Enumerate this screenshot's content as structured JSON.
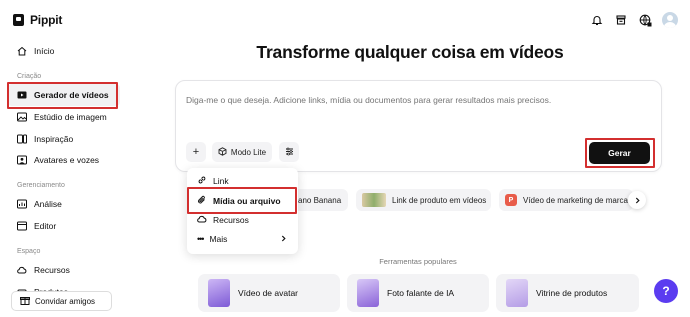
{
  "app": {
    "brand": "Pippit"
  },
  "sidebar": {
    "items": [
      {
        "label": "Início",
        "icon": "home-icon"
      },
      {
        "label": "Gerador de vídeos",
        "icon": "video-generator-icon"
      },
      {
        "label": "Estúdio de imagem",
        "icon": "image-studio-icon"
      },
      {
        "label": "Inspiração",
        "icon": "inspiration-icon"
      },
      {
        "label": "Avatares e vozes",
        "icon": "avatar-voice-icon"
      },
      {
        "label": "Análise",
        "icon": "analytics-icon"
      },
      {
        "label": "Editor",
        "icon": "editor-icon"
      },
      {
        "label": "Recursos",
        "icon": "cloud-icon"
      },
      {
        "label": "Produtos",
        "icon": "products-icon"
      }
    ],
    "sections": {
      "creation": "Criação",
      "management": "Gerenciamento",
      "space": "Espaço"
    },
    "invite_label": "Convidar amigos",
    "active_item": "Gerador de vídeos"
  },
  "header": {
    "icons": [
      "bell-icon",
      "archive-icon",
      "language-icon",
      "user-avatar"
    ]
  },
  "main": {
    "title": "Transforme qualquer coisa em vídeos",
    "prompt_placeholder": "Diga-me o que deseja. Adicione links, mídia ou documentos para gerar resultados mais precisos.",
    "add_label": "+",
    "mode_label": "Modo Lite",
    "generate_label": "Gerar"
  },
  "dropdown": {
    "items": [
      {
        "label": "Link",
        "icon": "link-icon"
      },
      {
        "label": "Mídia ou arquivo",
        "icon": "paperclip-icon"
      },
      {
        "label": "Recursos",
        "icon": "cloud-icon"
      },
      {
        "label": "Mais",
        "icon": "more-icon"
      }
    ]
  },
  "suggestions": [
    {
      "label": "ano Banana"
    },
    {
      "label": "Link de produto em vídeos"
    },
    {
      "label": "Vídeo de marketing de marca",
      "badge": "P"
    }
  ],
  "popular": {
    "title": "Ferramentas populares",
    "tools": [
      {
        "label": "Vídeo de avatar"
      },
      {
        "label": "Foto falante de IA"
      },
      {
        "label": "Vitrine de produtos"
      }
    ]
  },
  "help": {
    "label": "?"
  },
  "colors": {
    "highlight": "#d32f2f",
    "primary_button": "#111111",
    "help_button": "#5b3cf0",
    "chip_bg": "#f3f3f5",
    "badge_red": "#e85c4a"
  }
}
